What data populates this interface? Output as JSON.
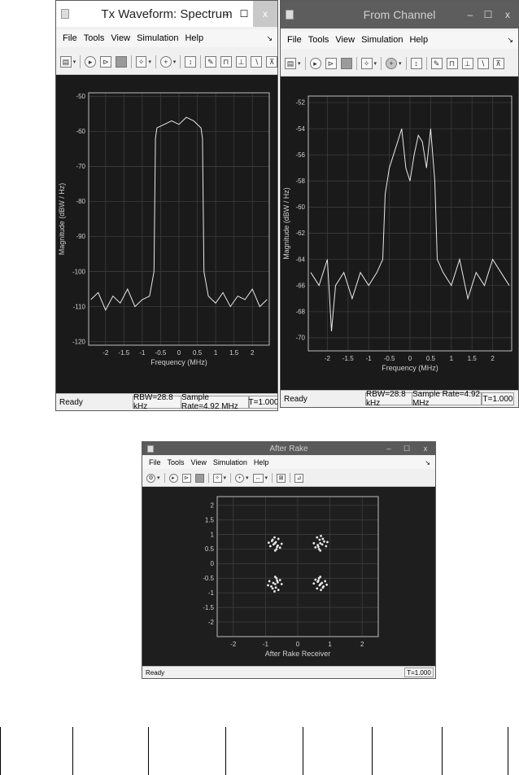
{
  "menu": [
    "File",
    "Tools",
    "View",
    "Simulation",
    "Help"
  ],
  "window_controls": {
    "minimize": "–",
    "maximize": "☐",
    "close": "x"
  },
  "windows": {
    "tx": {
      "title": "Tx Waveform: Spectrum",
      "status": {
        "ready": "Ready",
        "rbw": "RBW=28.8 kHz",
        "sample_rate": "Sample Rate=4.92 MHz",
        "time": "T=1.000"
      }
    },
    "channel": {
      "title": "From Channel",
      "status": {
        "ready": "Ready",
        "rbw": "RBW=28.8 kHz",
        "sample_rate": "Sample Rate=4.92 MHz",
        "time": "T=1.000"
      }
    },
    "rake": {
      "title": "After Rake",
      "status": {
        "ready": "Ready",
        "time": "T=1.000"
      }
    }
  },
  "colors": {
    "plot_bg": "#1a1a1a",
    "trace": "#e8e8e8",
    "grid": "#3c3c3c",
    "frame": "#bdbdbd"
  },
  "chart_data": [
    {
      "type": "line",
      "xlabel": "Frequency (MHz)",
      "ylabel": "Magnitude (dBW / Hz)",
      "xlim": [
        -2.46,
        2.46
      ],
      "ylim": [
        -121,
        -49
      ],
      "xticks": [
        "-2",
        "-1.5",
        "-1",
        "-0.5",
        "0",
        "0.5",
        "1",
        "1.5",
        "2"
      ],
      "xtick_values": [
        -2,
        -1.5,
        -1,
        -0.5,
        0,
        0.5,
        1,
        1.5,
        2
      ],
      "yticks": [
        "-50",
        "-60",
        "-70",
        "-80",
        "-90",
        "-100",
        "-110",
        "-120"
      ],
      "ytick_values": [
        -50,
        -60,
        -70,
        -80,
        -90,
        -100,
        -110,
        -120
      ],
      "grid": true,
      "series": [
        {
          "x": [
            -2.4,
            -2.2,
            -2.0,
            -1.8,
            -1.6,
            -1.4,
            -1.2,
            -1.0,
            -0.8,
            -0.68,
            -0.64,
            -0.6,
            -0.4,
            -0.2,
            0.0,
            0.2,
            0.4,
            0.6,
            0.64,
            0.68,
            0.8,
            1.0,
            1.2,
            1.4,
            1.6,
            1.8,
            2.0,
            2.2,
            2.4
          ],
          "y": [
            -108,
            -106,
            -111,
            -107,
            -109,
            -105,
            -110,
            -108,
            -107,
            -100,
            -62,
            -59,
            -58,
            -57,
            -58,
            -56,
            -57,
            -59,
            -62,
            -100,
            -107,
            -109,
            -106,
            -110,
            -107,
            -108,
            -105,
            -110,
            -108
          ]
        }
      ]
    },
    {
      "type": "line",
      "xlabel": "Frequency (MHz)",
      "ylabel": "Magnitude (dBW / Hz)",
      "xlim": [
        -2.46,
        2.46
      ],
      "ylim": [
        -71,
        -51.5
      ],
      "xticks": [
        "-2",
        "-1.5",
        "-1",
        "-0.5",
        "0",
        "0.5",
        "1",
        "1.5",
        "2"
      ],
      "xtick_values": [
        -2,
        -1.5,
        -1,
        -0.5,
        0,
        0.5,
        1,
        1.5,
        2
      ],
      "yticks": [
        "-52",
        "-54",
        "-56",
        "-58",
        "-60",
        "-62",
        "-64",
        "-66",
        "-68",
        "-70"
      ],
      "ytick_values": [
        -52,
        -54,
        -56,
        -58,
        -60,
        -62,
        -64,
        -66,
        -68,
        -70
      ],
      "grid": true,
      "series": [
        {
          "x": [
            -2.4,
            -2.2,
            -2.0,
            -1.9,
            -1.8,
            -1.6,
            -1.4,
            -1.2,
            -1.0,
            -0.8,
            -0.66,
            -0.6,
            -0.5,
            -0.4,
            -0.3,
            -0.2,
            -0.1,
            0.0,
            0.1,
            0.2,
            0.3,
            0.4,
            0.5,
            0.6,
            0.66,
            0.8,
            1.0,
            1.2,
            1.4,
            1.6,
            1.8,
            2.0,
            2.2,
            2.4
          ],
          "y": [
            -65,
            -66,
            -64,
            -69.5,
            -66,
            -65,
            -67,
            -65,
            -66,
            -65,
            -64,
            -59,
            -57,
            -56,
            -55,
            -54,
            -57,
            -58,
            -56,
            -54.5,
            -55,
            -57,
            -54,
            -58,
            -64,
            -65,
            -66,
            -64,
            -67,
            -65,
            -66,
            -64,
            -65,
            -66
          ]
        }
      ]
    },
    {
      "type": "scatter",
      "xlabel": "After Rake Receiver",
      "ylabel": "",
      "xlim": [
        -2.5,
        2.5
      ],
      "ylim": [
        -2.5,
        2.3
      ],
      "xticks": [
        "-2",
        "-1",
        "0",
        "1",
        "2"
      ],
      "xtick_values": [
        -2,
        -1,
        0,
        1,
        2
      ],
      "yticks": [
        "2",
        "1.5",
        "1",
        "0.5",
        "0",
        "-0.5",
        "-1",
        "-1.5",
        "-2"
      ],
      "ytick_values": [
        2,
        1.5,
        1,
        0.5,
        0,
        -0.5,
        -1,
        -1.5,
        -2
      ],
      "grid": true,
      "series": [
        {
          "x": [
            -0.71,
            -0.62,
            -0.8,
            -0.55,
            -0.68,
            -0.75,
            -0.6,
            -0.85,
            -0.66,
            -0.72,
            -0.5,
            -0.9,
            -0.64,
            -0.78,
            -0.7,
            0.7,
            0.62,
            0.82,
            0.55,
            0.68,
            0.76,
            0.6,
            0.88,
            0.66,
            0.72,
            0.5,
            0.92,
            0.64,
            0.78,
            0.7,
            -0.7,
            -0.62,
            -0.82,
            -0.55,
            -0.68,
            -0.76,
            -0.6,
            -0.88,
            -0.66,
            -0.72,
            -0.5,
            -0.92,
            -0.64,
            -0.78,
            -0.7,
            0.71,
            0.62,
            0.8,
            0.55,
            0.68,
            0.75,
            0.6,
            0.85,
            0.66,
            0.72,
            0.5,
            0.9,
            0.64,
            0.78,
            0.7
          ],
          "y": [
            0.7,
            0.62,
            0.78,
            0.55,
            0.74,
            0.66,
            0.85,
            0.6,
            0.5,
            0.9,
            0.68,
            0.72,
            0.58,
            0.82,
            0.45,
            0.7,
            0.64,
            0.76,
            0.56,
            0.82,
            0.66,
            0.9,
            0.6,
            0.5,
            0.95,
            0.7,
            0.74,
            0.58,
            0.85,
            0.45,
            -0.7,
            -0.64,
            -0.78,
            -0.56,
            -0.82,
            -0.66,
            -0.9,
            -0.6,
            -0.5,
            -0.95,
            -0.7,
            -0.74,
            -0.58,
            -0.85,
            -0.45,
            -0.7,
            -0.62,
            -0.78,
            -0.55,
            -0.74,
            -0.66,
            -0.85,
            -0.6,
            -0.5,
            -0.9,
            -0.68,
            -0.72,
            -0.58,
            -0.82,
            -0.45
          ]
        }
      ]
    }
  ]
}
